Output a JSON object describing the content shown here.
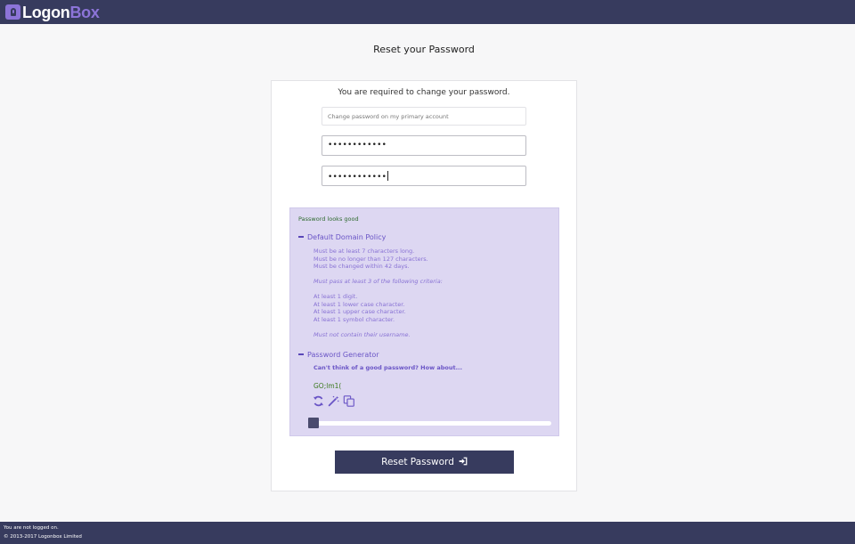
{
  "header": {
    "logo_part1": "Logon",
    "logo_part2": "Box",
    "accent_color": "#8c74d8",
    "bar_color": "#373b5e"
  },
  "page": {
    "title": "Reset your Password"
  },
  "form": {
    "intro": "You are required to change your password.",
    "account_field_value": "Change password on my primary account",
    "new_password_dots": "••••••••••••",
    "confirm_password_dots": "••••••••••••"
  },
  "policy": {
    "status": "Password looks good",
    "section_title": "Default Domain Policy",
    "length_rules": [
      "Must be at least 7 characters long.",
      "Must be no longer than 127 characters.",
      "Must be changed within 42 days."
    ],
    "criteria_heading": "Must pass at least 3 of the following criteria:",
    "criteria": [
      "At least 1 digit.",
      "At least 1 lower case character.",
      "At least 1 upper case character.",
      "At least 1 symbol character."
    ],
    "username_rule": "Must not contain their username."
  },
  "generator": {
    "section_title": "Password Generator",
    "prompt": "Can't think of a good password? How about...",
    "suggestion": "GO;lm1(",
    "icons": [
      "refresh-icon",
      "magic-wand-icon",
      "copy-icon"
    ],
    "length_slider_level": 0
  },
  "actions": {
    "reset_label": "Reset Password",
    "reset_icon": "sign-in-icon"
  },
  "footer": {
    "login_status": "You are not logged on.",
    "copyright": "© 2013-2017 Logonbox Limited"
  }
}
